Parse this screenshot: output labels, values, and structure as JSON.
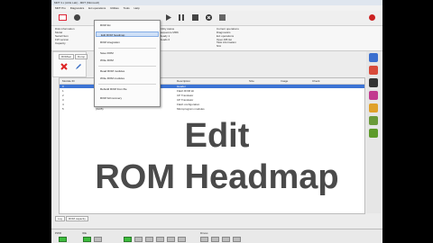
{
  "window": {
    "title": "MRT 3.x (ACE Lab) - MRT (Microsoft)"
  },
  "menubar": [
    "MRT Pro",
    "Diagnostics",
    "Ext operations",
    "Utilities",
    "Tools",
    "Help"
  ],
  "toolbar": {
    "buttons": [
      "terminal-icon",
      "power-icon",
      "play-icon",
      "pause-icon",
      "stop-icon",
      "close-icon",
      "settings-icon",
      "record-icon"
    ]
  },
  "infobar": {
    "disk_info_title": "Disk information",
    "disk_info_lines": [
      "Model",
      "Serial Num",
      "FW version",
      "Capacity"
    ],
    "utility_status_title": "Utility status",
    "utility_lines": [
      "Sequence MRK",
      "Ready 1",
      "Reads 0"
    ],
    "smart_title": "Current operations",
    "smart_lines": [
      "Diagnostics",
      "Ext operations",
      "Open DB list"
    ],
    "task_title": "Task information",
    "task_value": "N/A"
  },
  "tabs": [
    "ROMset",
    "Dump"
  ],
  "dropdown": {
    "items": [
      "ROM list",
      "Edit ROM headmap",
      "ROM integration",
      "Save ROM",
      "Write ROM",
      "Read ROM modules",
      "Write ROM modules",
      "Rebuild ROM from file",
      "ROM full recovery"
    ],
    "highlighted": "Edit ROM headmap"
  },
  "table": {
    "columns": [
      "Module ID",
      "Type",
      "Description",
      "Size",
      "Image",
      "Check"
    ],
    "rows": [
      [
        "0",
        "(0x00)",
        "Header",
        "",
        "",
        ""
      ],
      [
        "1",
        "(0x01)",
        "Flash ROM kit",
        "",
        "",
        ""
      ],
      [
        "2",
        "(0x02)",
        "CP Translator",
        "",
        "",
        ""
      ],
      [
        "3",
        "(0x03)",
        "CP Translator",
        "",
        "",
        ""
      ],
      [
        "4",
        "(0x04)",
        "Flash configuration",
        "",
        "",
        ""
      ],
      [
        "5",
        "(0x05)",
        "Microprogram modules",
        "",
        "",
        ""
      ]
    ]
  },
  "overlay": {
    "line1": "Edit",
    "line2": "ROM Headmap"
  },
  "bottom_tabs": [
    "Log",
    "ROM capacity"
  ],
  "status": {
    "labels": [
      "PWR",
      "IDE",
      "Drives"
    ],
    "leds": [
      "DRD",
      "DRQ",
      "DRDY",
      "DF",
      "DSC",
      "SBY",
      "CORR",
      "IDX",
      "ERR"
    ]
  },
  "colors": {
    "accent": "#3b73d4",
    "led_on": "#3dbb3d"
  }
}
